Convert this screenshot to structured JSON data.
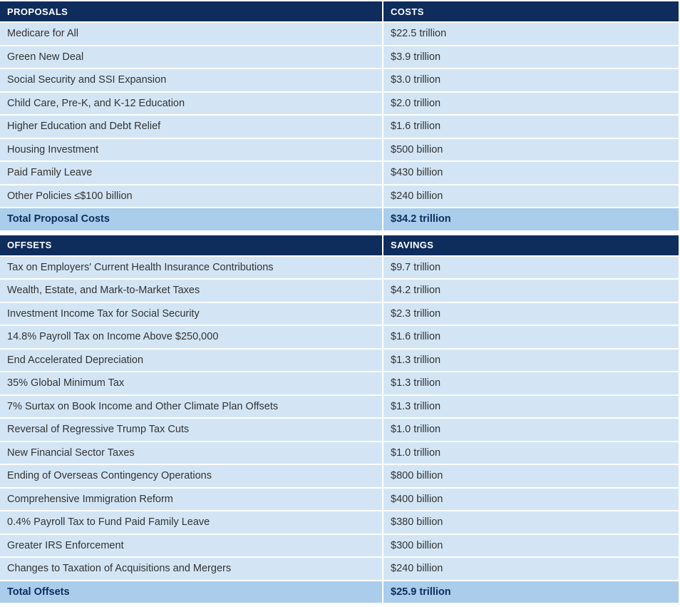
{
  "proposals": {
    "header": {
      "label": "PROPOSALS",
      "value": "COSTS"
    },
    "rows": [
      {
        "label": "Medicare for All",
        "value": "$22.5 trillion"
      },
      {
        "label": "Green New Deal",
        "value": "$3.9 trillion"
      },
      {
        "label": "Social Security and SSI Expansion",
        "value": "$3.0 trillion"
      },
      {
        "label": "Child Care, Pre-K, and K-12 Education",
        "value": "$2.0 trillion"
      },
      {
        "label": "Higher Education and Debt Relief",
        "value": "$1.6 trillion"
      },
      {
        "label": "Housing Investment",
        "value": "$500 billion"
      },
      {
        "label": "Paid Family Leave",
        "value": "$430 billion"
      },
      {
        "label": "Other Policies ≤$100 billion",
        "value": "$240 billion"
      }
    ],
    "total": {
      "label": "Total Proposal Costs",
      "value": "$34.2 trillion"
    }
  },
  "offsets": {
    "header": {
      "label": "OFFSETS",
      "value": "SAVINGS"
    },
    "rows": [
      {
        "label": "Tax on Employers' Current Health Insurance Contributions",
        "value": "$9.7 trillion"
      },
      {
        "label": "Wealth, Estate, and Mark-to-Market Taxes",
        "value": "$4.2 trillion"
      },
      {
        "label": "Investment Income Tax for Social Security",
        "value": "$2.3 trillion"
      },
      {
        "label": "14.8% Payroll Tax on Income Above $250,000",
        "value": "$1.6 trillion"
      },
      {
        "label": "End Accelerated Depreciation",
        "value": "$1.3 trillion"
      },
      {
        "label": "35% Global Minimum Tax",
        "value": "$1.3 trillion"
      },
      {
        "label": "7% Surtax on Book Income and Other Climate Plan Offsets",
        "value": "$1.3 trillion"
      },
      {
        "label": "Reversal of Regressive Trump Tax Cuts",
        "value": "$1.0 trillion"
      },
      {
        "label": "New Financial Sector Taxes",
        "value": "$1.0 trillion"
      },
      {
        "label": "Ending of Overseas Contingency Operations",
        "value": "$800 billion"
      },
      {
        "label": "Comprehensive Immigration Reform",
        "value": "$400 billion"
      },
      {
        "label": "0.4% Payroll Tax to Fund Paid Family Leave",
        "value": "$380 billion"
      },
      {
        "label": "Greater IRS Enforcement",
        "value": "$300 billion"
      },
      {
        "label": "Changes to Taxation of Acquisitions and Mergers",
        "value": "$240 billion"
      }
    ],
    "total": {
      "label": "Total Offsets",
      "value": "$25.9 trillion"
    }
  },
  "colors": {
    "header_bg": "#0e2d5c",
    "row_bg": "#d3e5f5",
    "total_bg": "#a9cdea"
  }
}
